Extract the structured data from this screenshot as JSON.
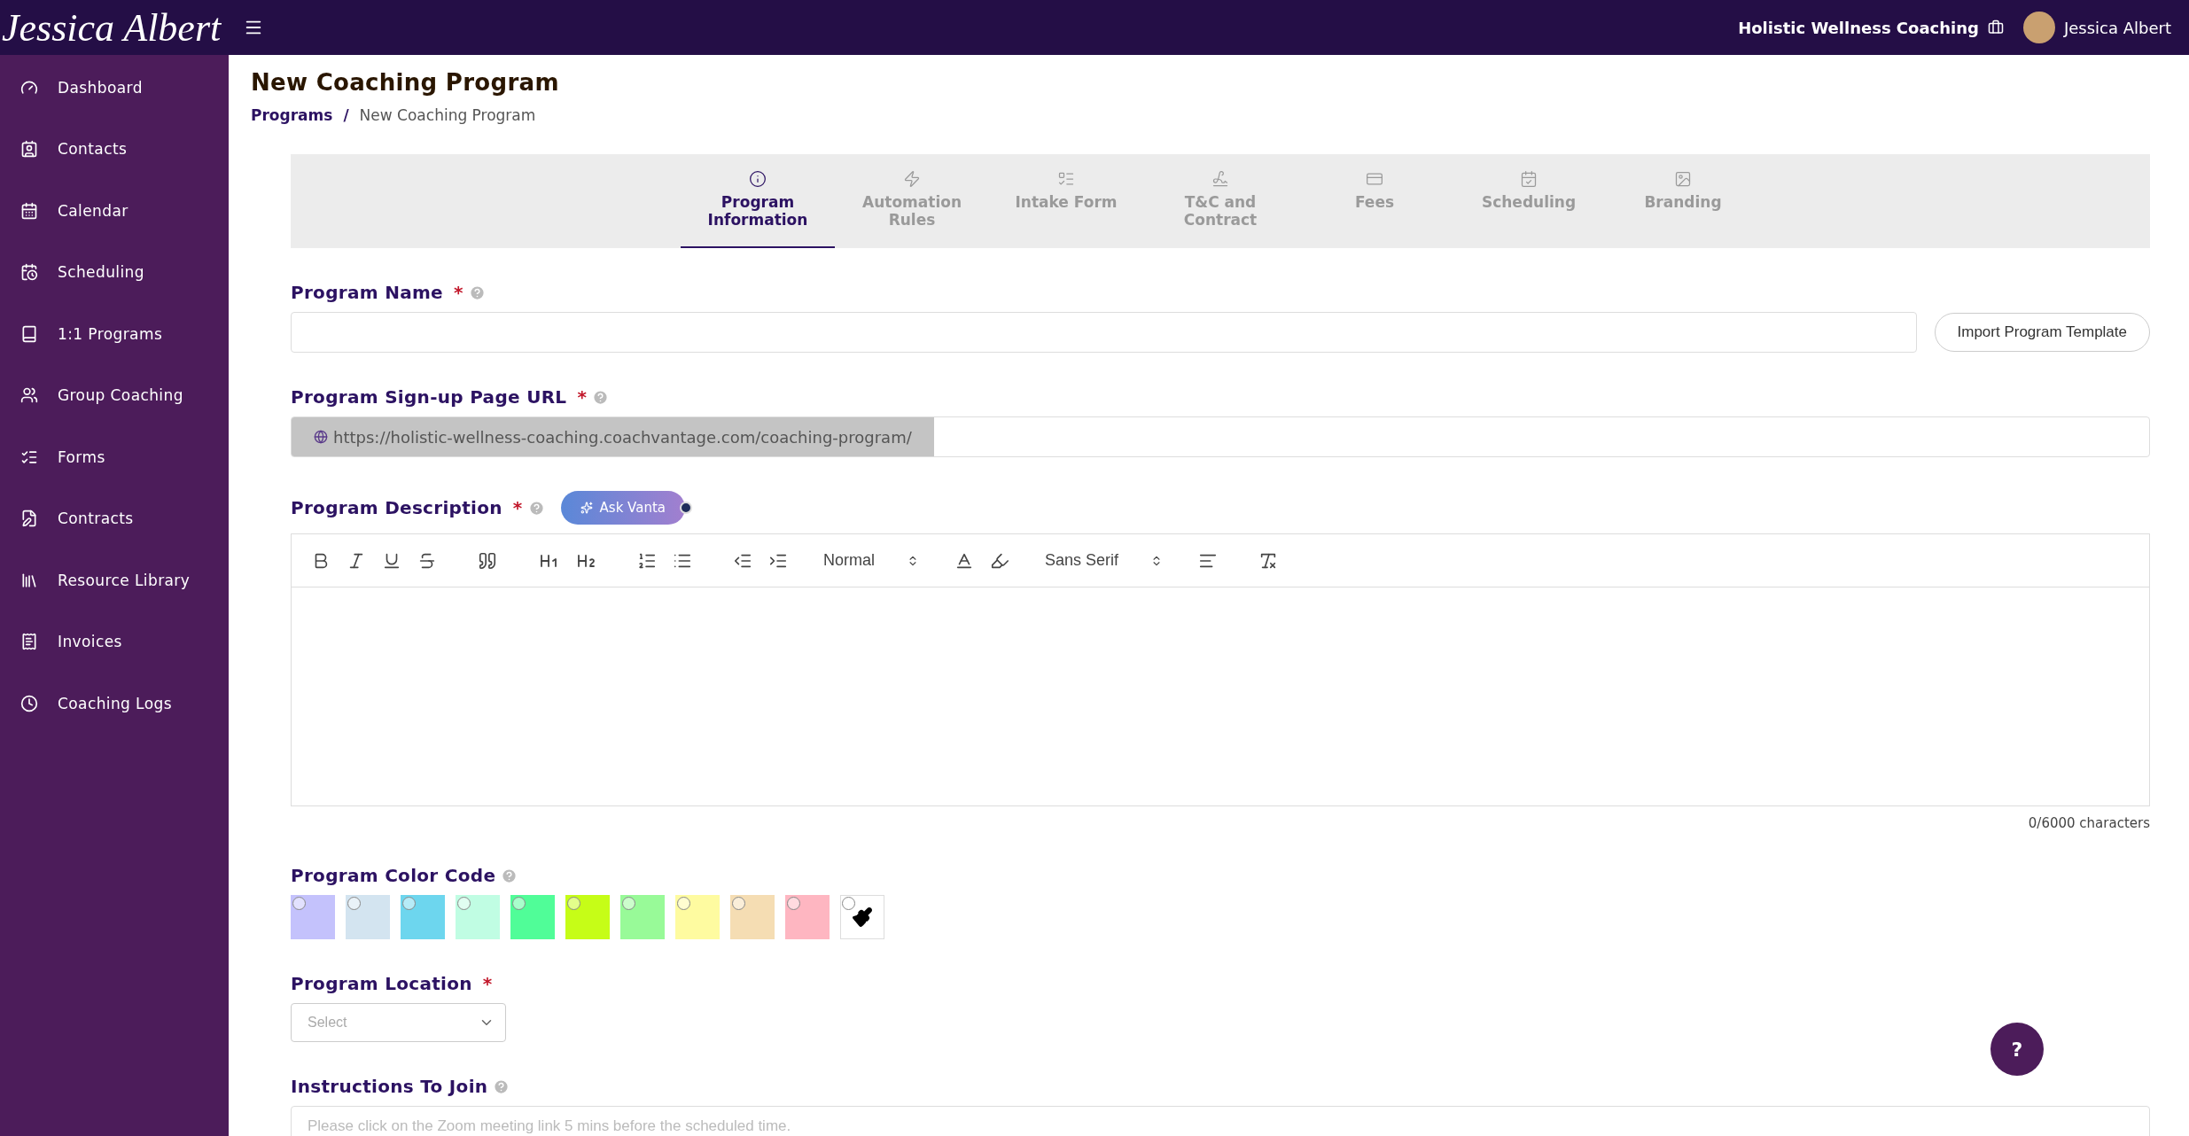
{
  "topbar": {
    "logo": "Jessica Albert",
    "business": "Holistic Wellness Coaching",
    "user": "Jessica Albert"
  },
  "sidebar": {
    "items": [
      {
        "label": "Dashboard",
        "selected": false
      },
      {
        "label": "Contacts",
        "selected": false
      },
      {
        "label": "Calendar",
        "selected": false
      },
      {
        "label": "Scheduling",
        "selected": false
      },
      {
        "label": "1:1 Programs",
        "selected": false
      },
      {
        "label": "Group Coaching",
        "selected": false
      },
      {
        "label": "Forms",
        "selected": false
      },
      {
        "label": "Contracts",
        "selected": false
      },
      {
        "label": "Resource Library",
        "selected": false
      },
      {
        "label": "Invoices",
        "selected": false
      },
      {
        "label": "Coaching Logs",
        "selected": false
      }
    ]
  },
  "page": {
    "title": "New Coaching Program",
    "breadcrumb": [
      {
        "label": "Programs",
        "kind": "link"
      },
      {
        "label": "/",
        "kind": "separator"
      },
      {
        "label": "New Coaching Program",
        "kind": "current"
      }
    ]
  },
  "tabs": [
    {
      "label": "Program Information",
      "selected": true
    },
    {
      "label": "Automation Rules",
      "selected": false
    },
    {
      "label": "Intake Form",
      "selected": false
    },
    {
      "label": "T&C and Contract",
      "selected": false
    },
    {
      "label": "Fees",
      "selected": false
    },
    {
      "label": "Scheduling",
      "selected": false
    },
    {
      "label": "Branding",
      "selected": false
    }
  ],
  "form": {
    "program_name": {
      "label": "Program Name",
      "required_mark": "*",
      "button": "Import Program Template"
    },
    "url": {
      "label": "Program Sign-up Page URL",
      "required_mark": "*",
      "prefix": "https://holistic-wellness-coaching.coachvantage.com/coaching-program/"
    },
    "description": {
      "label": "Program Description",
      "required_mark": "*",
      "ai_button": "Ask Vanta",
      "header_select": "Normal",
      "font_select": "Sans Serif",
      "counter": "0/6000 characters"
    },
    "color_code": {
      "label": "Program Color Code",
      "swatches": [
        {
          "kind": "color",
          "color": "#c4c2fc",
          "selected": false
        },
        {
          "kind": "color",
          "color": "#d3e4f0",
          "selected": false
        },
        {
          "kind": "color",
          "color": "#6dd6ee",
          "selected": false
        },
        {
          "kind": "color",
          "color": "#c0fde3",
          "selected": false
        },
        {
          "kind": "color",
          "color": "#50fd98",
          "selected": false
        },
        {
          "kind": "color",
          "color": "#c6fd17",
          "selected": false
        },
        {
          "kind": "color",
          "color": "#98fa98",
          "selected": false
        },
        {
          "kind": "color",
          "color": "#fefba0",
          "selected": false
        },
        {
          "kind": "color",
          "color": "#f5ddb3",
          "selected": false
        },
        {
          "kind": "color",
          "color": "#feb6c1",
          "selected": false
        },
        {
          "kind": "custom",
          "selected": false
        }
      ]
    },
    "location": {
      "label": "Program Location",
      "required_mark": "*",
      "placeholder": "Select"
    },
    "instructions": {
      "label": "Instructions To Join",
      "placeholder": "Please click on the Zoom meeting link 5 mins before the scheduled time."
    }
  },
  "help_button": "?"
}
